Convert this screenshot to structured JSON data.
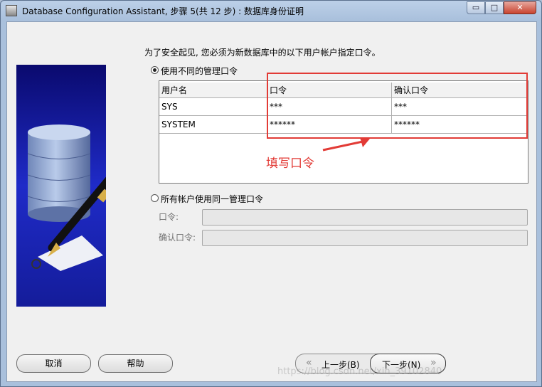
{
  "window": {
    "title": "Database Configuration Assistant, 步骤 5(共 12 步) : 数据库身份证明",
    "controls": {
      "minimize": "▭",
      "maximize": "□",
      "close": "✕"
    }
  },
  "instruction": "为了安全起见, 您必须为新数据库中的以下用户帐户指定口令。",
  "options": {
    "different_passwords": {
      "label": "使用不同的管理口令",
      "selected": true
    },
    "same_password": {
      "label": "所有帐户使用同一管理口令",
      "selected": false
    }
  },
  "table": {
    "headers": [
      "用户名",
      "口令",
      "确认口令"
    ],
    "rows": [
      {
        "user": "SYS",
        "password": "***",
        "confirm": "***"
      },
      {
        "user": "SYSTEM",
        "password": "******",
        "confirm": "******"
      }
    ]
  },
  "annotation": "填写口令",
  "shared_fields": {
    "password_label": "口令:",
    "confirm_label": "确认口令:"
  },
  "buttons": {
    "cancel": "取消",
    "help": "帮助",
    "back": "上一步(B)",
    "next": "下一步(N)"
  },
  "watermark": "https://blog.csdn.net/xin_39102840",
  "colors": {
    "annotation": "#e23b36",
    "image_background": "#1f2bc8"
  }
}
